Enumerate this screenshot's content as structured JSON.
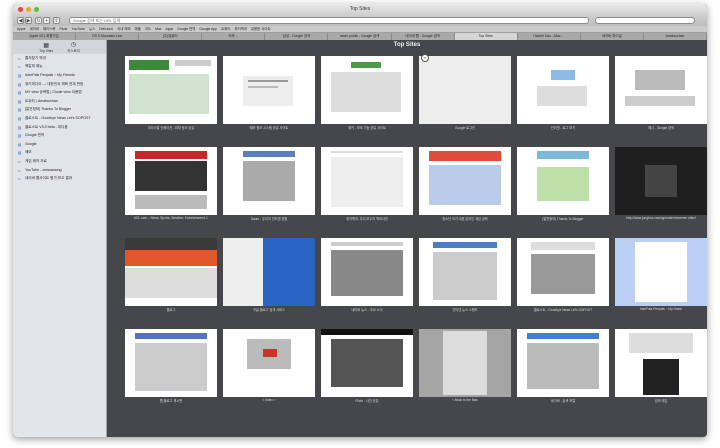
{
  "window": {
    "title": "Top Sites"
  },
  "toolbar": {
    "url": "Google 검색 또는 URL 입력",
    "back_label": "◀",
    "forward_label": "▶"
  },
  "bookmarks": [
    "Apple",
    "네이버",
    "페이스북",
    "Flickr",
    "YouTube",
    "뉴스",
    "Delicious",
    "국내·해외",
    "애플",
    "지도",
    "Mac",
    "Apps",
    "Google 번역",
    "Google App",
    "트위터",
    "위키백과",
    "유용한 사이트"
  ],
  "tabs": [
    {
      "label": "Apple 오디 회원가입"
    },
    {
      "label": "OS X Mountain Lion"
    },
    {
      "label": "(주)컴퓨터"
    },
    {
      "label": "어제 ..."
    },
    {
      "label": "삼성 - Google 검색"
    },
    {
      "label": "naver public - Google 검색"
    },
    {
      "label": "네이버 웹 - Google 검색"
    },
    {
      "label": "Top Sites",
      "active": true
    },
    {
      "label": "Hacker Dao - Mac ..."
    },
    {
      "label": "네이버 파이널"
    },
    {
      "label": "Amatsuchan"
    }
  ],
  "sidebar": {
    "tab_topsites": "Top Sites",
    "tab_history": "히스토리",
    "items": [
      {
        "label": "즐겨찾기 막대",
        "icon": "folder"
      },
      {
        "label": "책갈피 메뉴",
        "icon": "folder"
      },
      {
        "label": "InterPals Penpals :: My Friends",
        "icon": "page"
      },
      {
        "label": "위키피디아 — 대한민국 체육 연계 판정",
        "icon": "page"
      },
      {
        "label": "MY view 공략법 | Clouie view 이용법",
        "icon": "page"
      },
      {
        "label": "트위터 | Amatsuchan",
        "icon": "page"
      },
      {
        "label": "[알찬정보] Thanks To Blogger",
        "icon": "page"
      },
      {
        "label": "클로스트 - Goodbye News Let's DOPOST",
        "icon": "page"
      },
      {
        "label": "클로스트 V3.0 beta - 미디움",
        "icon": "page"
      },
      {
        "label": "Google 번역",
        "icon": "page"
      },
      {
        "label": "Google",
        "icon": "page"
      },
      {
        "label": "메모",
        "icon": "page"
      },
      {
        "label": "게임 제작 자료",
        "icon": "folder"
      },
      {
        "label": "YouTube - crosswoong",
        "icon": "folder"
      },
      {
        "label": "네이버 웹사이트 평가 보고 결과",
        "icon": "folder"
      }
    ]
  },
  "content": {
    "title": "Top Sites"
  },
  "tiles": [
    {
      "caption": "크리스탈 인베이션 - 외부 링크 공유"
    },
    {
      "caption": "예비 정보 시스템 공유 사이트"
    },
    {
      "caption": "위키 - 보조 기능 공유 사이트"
    },
    {
      "caption": "Google 로그인"
    },
    {
      "caption": "인터넷 - 로그 보기"
    },
    {
      "caption": "예시 - Google 검색"
    },
    {
      "caption": "AOL.com – News, Sports, Weather, Entertainment, L"
    },
    {
      "caption": "Daum - 우리의 인터넷 경험"
    },
    {
      "caption": "위키백과, 우리 모두의 백과사전"
    },
    {
      "caption": "청소년 국가 대표 온라인 게임 공략"
    },
    {
      "caption": "[알찬정보] Thanks To Blogger"
    },
    {
      "caption": "http://www.jungtrux.com/ipp/main/mmmmm.shtml"
    },
    {
      "caption": "블로그"
    },
    {
      "caption": "구글 블로그 검색 서비스"
    },
    {
      "caption": "네이버 뉴스 - 주요 소식"
    },
    {
      "caption": "인터넷 뉴스 스탠드"
    },
    {
      "caption": "클로스트 - Goodbye News Let's DOPOST"
    },
    {
      "caption": "InterPals Penpals :: My Home"
    },
    {
      "caption": "웹 블로그 게시판"
    },
    {
      "caption": "< Index >"
    },
    {
      "caption": "Flickr - 사진 공유"
    },
    {
      "caption": "< Back to the Mac"
    },
    {
      "caption": "네이버 - 검색 포털"
    },
    {
      "caption": "검색 게임"
    }
  ]
}
